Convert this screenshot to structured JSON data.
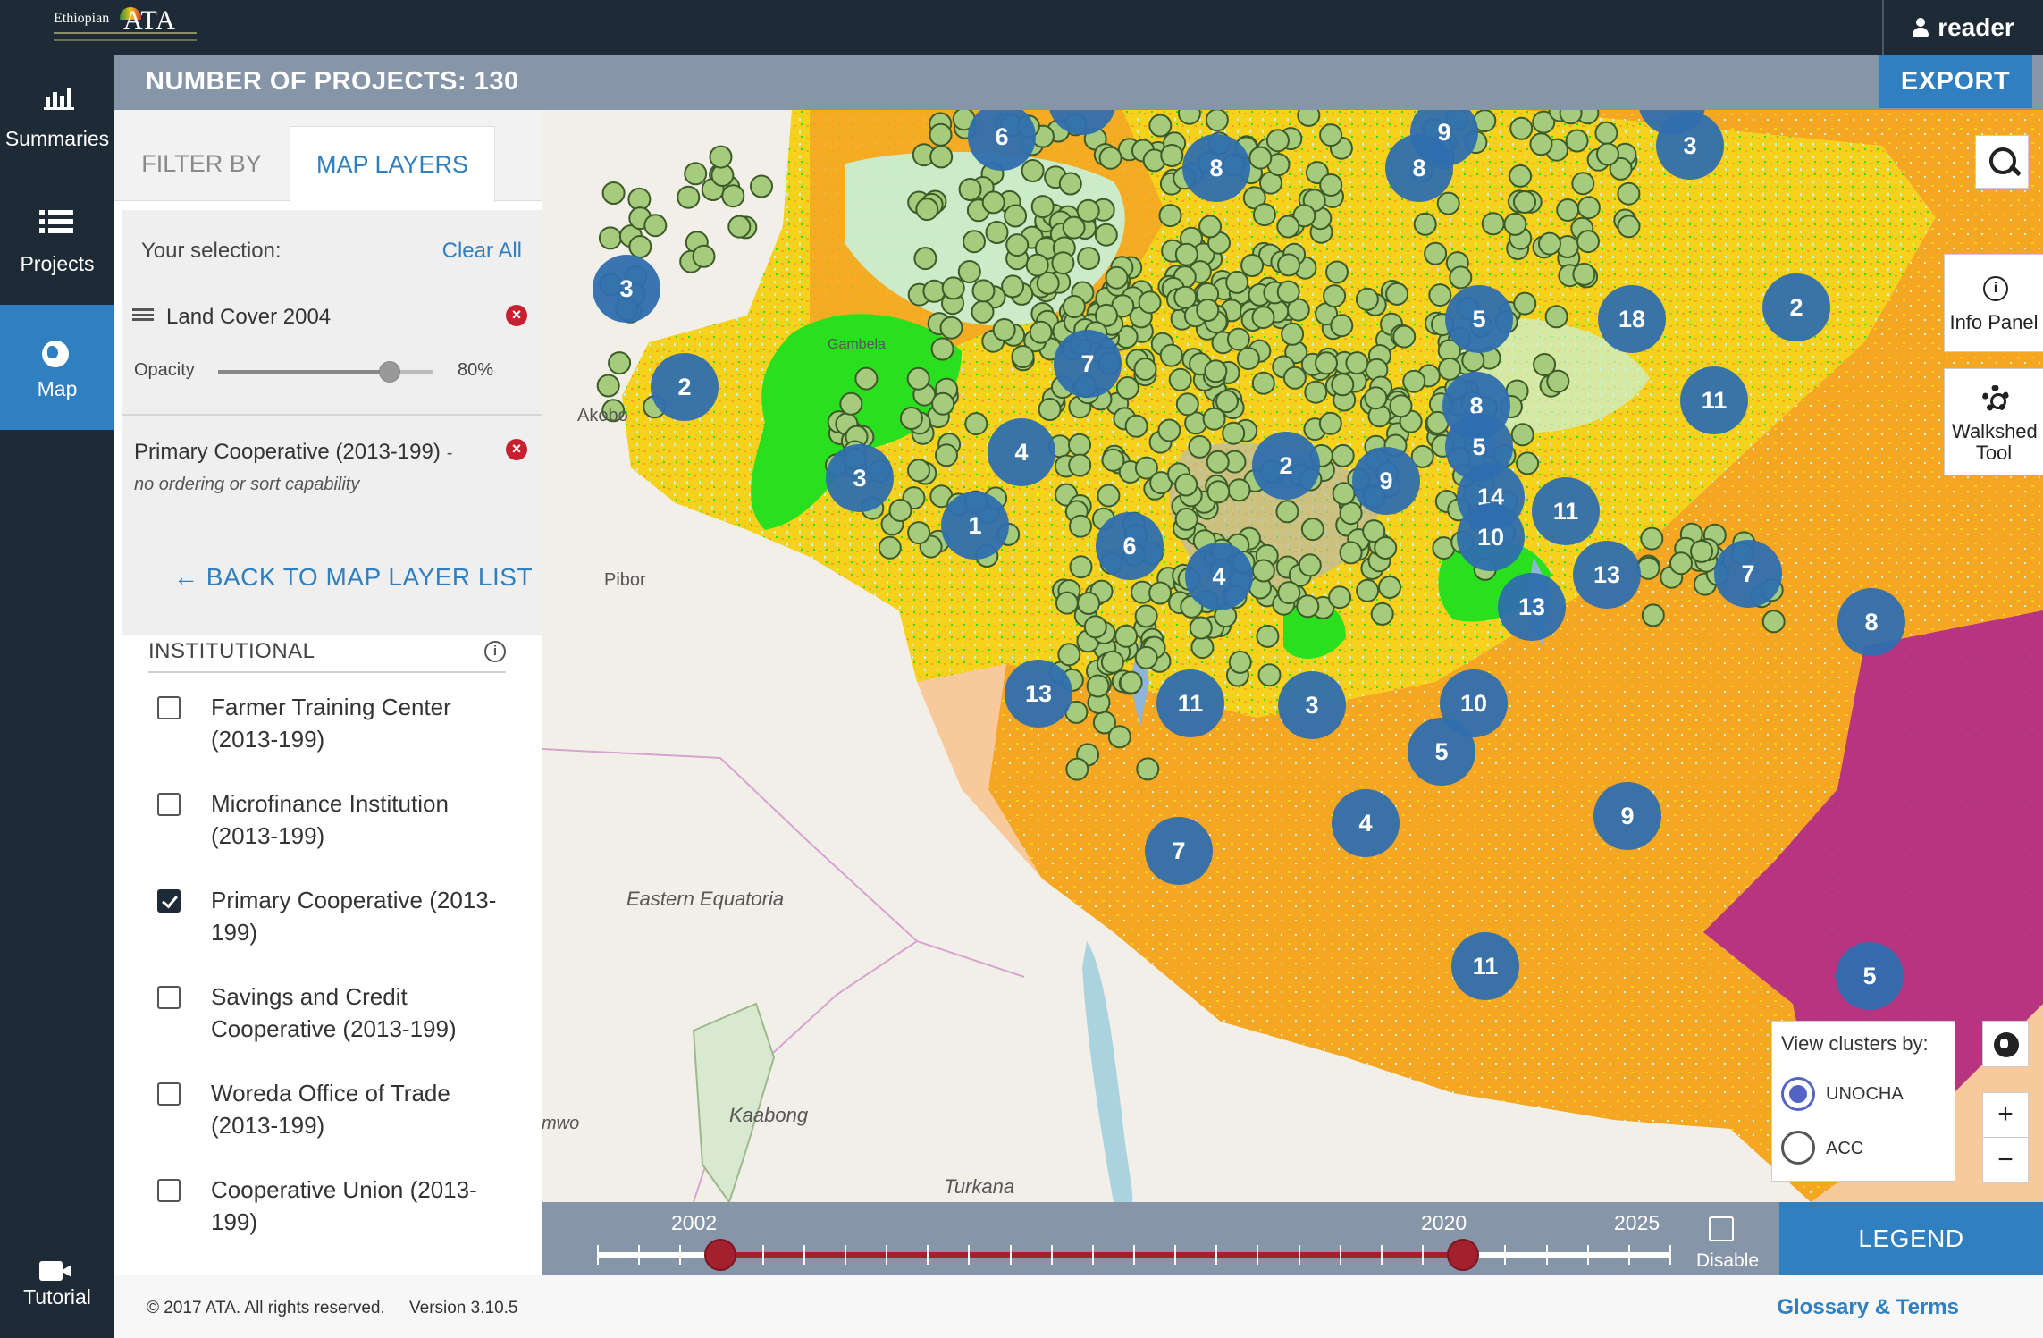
{
  "brand": {
    "logo_line1": "Ethiopian",
    "logo_ata": "ATA"
  },
  "user": {
    "name": "reader"
  },
  "nav": {
    "summaries": "Summaries",
    "projects": "Projects",
    "map": "Map",
    "tutorial": "Tutorial"
  },
  "header": {
    "project_count": "NUMBER OF PROJECTS: 130",
    "export": "EXPORT"
  },
  "panel": {
    "tab_filter": "FILTER BY",
    "tab_layers": "MAP LAYERS",
    "selection_title": "Your selection:",
    "clear_all": "Clear All",
    "layer1": {
      "name": "Land Cover 2004",
      "opacity_label": "Opacity",
      "opacity_value": "80%",
      "opacity": 0.8
    },
    "layer2": {
      "name": "Primary Cooperative (2013-199)",
      "note": "- no ordering or sort capability"
    },
    "back_link": "← BACK TO MAP LAYER LIST",
    "section_title": "INSTITUTIONAL",
    "options": [
      {
        "label": "Farmer Training Center (2013-199)",
        "checked": false
      },
      {
        "label": "Microfinance Institution (2013-199)",
        "checked": false
      },
      {
        "label": "Primary Cooperative (2013-199)",
        "checked": true
      },
      {
        "label": "Savings and Credit Cooperative (2013-199)",
        "checked": false
      },
      {
        "label": "Woreda Office of Trade (2013-199)",
        "checked": false
      },
      {
        "label": "Cooperative Union (2013-199)",
        "checked": false
      }
    ]
  },
  "map": {
    "place_labels": [
      "Akobo",
      "Pibor",
      "Eastern Equatoria",
      "Kaabong",
      "Turkana",
      "mwo",
      "Gambela"
    ],
    "cluster_counts": [
      "9",
      "3",
      "2",
      "9",
      "6",
      "8",
      "9",
      "3",
      "8",
      "5",
      "18",
      "7",
      "2",
      "8",
      "11",
      "3",
      "4",
      "9",
      "2",
      "5",
      "1",
      "14",
      "11",
      "6",
      "10",
      "13",
      "4",
      "7",
      "13",
      "8",
      "13",
      "11",
      "3",
      "10",
      "5",
      "4",
      "9",
      "7",
      "11",
      "5"
    ],
    "colors": {
      "cluster": "#2f6eae",
      "marker": "#a4cc7c",
      "orange": "#f5a623",
      "yellow": "#f7d21c",
      "green": "#28e01e",
      "magenta": "#b0288c",
      "peach": "#f8c99a",
      "mint": "#c7f2dc"
    }
  },
  "controls": {
    "info_panel": "Info Panel",
    "walkshed": "Walkshed Tool",
    "view_clusters_by": "View clusters by:",
    "cluster_options": [
      {
        "label": "UNOCHA",
        "selected": true
      },
      {
        "label": "ACC",
        "selected": false
      }
    ],
    "zoom_in": "+",
    "zoom_out": "−"
  },
  "timeline": {
    "start_label": "2002",
    "end_label": "2020",
    "max_label": "2025",
    "range_start": 2002,
    "range_end": 2020,
    "disable_label": "Disable",
    "legend": "LEGEND"
  },
  "footer": {
    "copyright": "© 2017 ATA. All rights reserved.",
    "version": "Version 3.10.5",
    "glossary": "Glossary & Terms"
  }
}
